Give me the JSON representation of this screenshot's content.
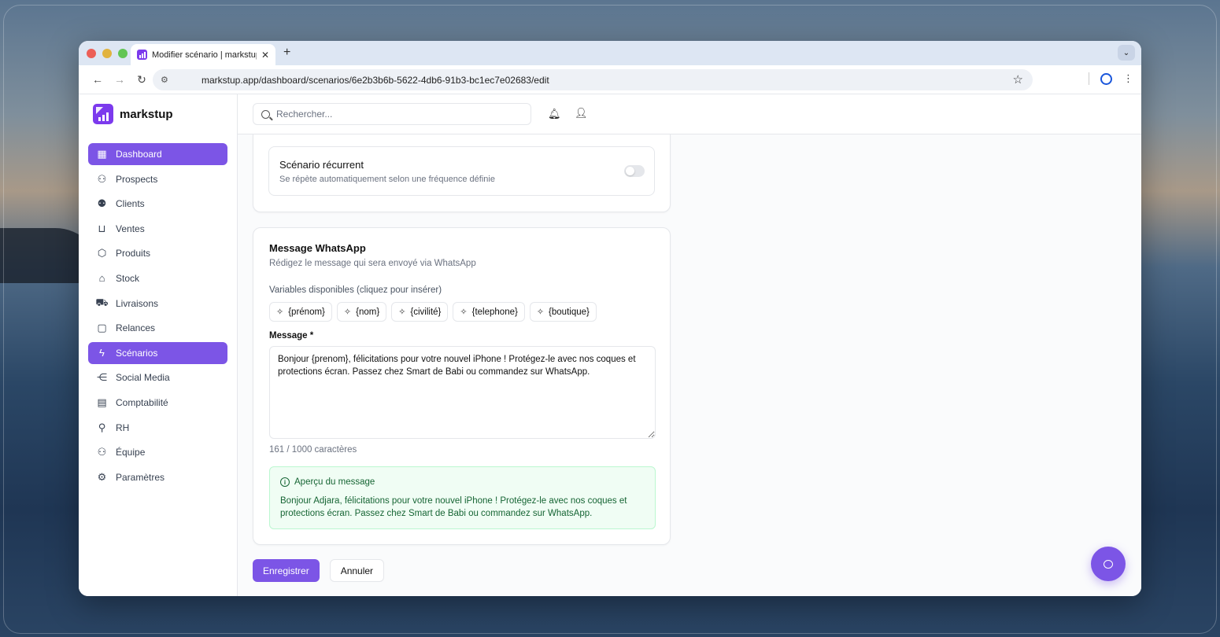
{
  "browser": {
    "tab_title": "Modifier scénario | markstup",
    "tab_close": "✕",
    "new_tab": "+",
    "url": "markstup.app/dashboard/scenarios/6e2b3b6b-5622-4db6-91b3-bc1ec7e02683/edit"
  },
  "app": {
    "brand": "markstup",
    "accent_color": "#7c55e6"
  },
  "search": {
    "placeholder": "Rechercher..."
  },
  "sidebar": {
    "items": [
      {
        "label": "Dashboard",
        "icon": "layout-grid-icon",
        "active": true
      },
      {
        "label": "Prospects",
        "icon": "user-plus-icon"
      },
      {
        "label": "Clients",
        "icon": "users-icon"
      },
      {
        "label": "Ventes",
        "icon": "cart-icon"
      },
      {
        "label": "Produits",
        "icon": "package-icon"
      },
      {
        "label": "Stock",
        "icon": "warehouse-icon"
      },
      {
        "label": "Livraisons",
        "icon": "truck-icon"
      },
      {
        "label": "Relances",
        "icon": "message-square-icon"
      },
      {
        "label": "Scénarios",
        "icon": "zap-icon",
        "active": true
      },
      {
        "label": "Social Media",
        "icon": "share-icon"
      },
      {
        "label": "Comptabilité",
        "icon": "calculator-icon"
      },
      {
        "label": "RH",
        "icon": "user-cog-icon"
      },
      {
        "label": "Équipe",
        "icon": "team-icon"
      },
      {
        "label": "Paramètres",
        "icon": "gear-icon"
      }
    ]
  },
  "recurrent": {
    "title": "Scénario récurrent",
    "description": "Se répète automatiquement selon une fréquence définie",
    "enabled": false
  },
  "whatsapp": {
    "title": "Message WhatsApp",
    "description": "Rédigez le message qui sera envoyé via WhatsApp",
    "variables_label": "Variables disponibles (cliquez pour insérer)",
    "variables": [
      "{prénom}",
      "{nom}",
      "{civilité}",
      "{telephone}",
      "{boutique}"
    ],
    "message_label": "Message *",
    "message_value": "Bonjour {prenom}, félicitations pour votre nouvel iPhone ! Protégez-le avec nos coques et protections écran. Passez chez Smart de Babi ou commandez sur WhatsApp.",
    "char_count": "161 / 1000 caractères",
    "preview_title": "Aperçu du message",
    "preview_text": "Bonjour Adjara, félicitations pour votre nouvel iPhone ! Protégez-le avec nos coques et protections écran. Passez chez Smart de Babi ou commandez sur WhatsApp."
  },
  "actions": {
    "save": "Enregistrer",
    "cancel": "Annuler"
  }
}
